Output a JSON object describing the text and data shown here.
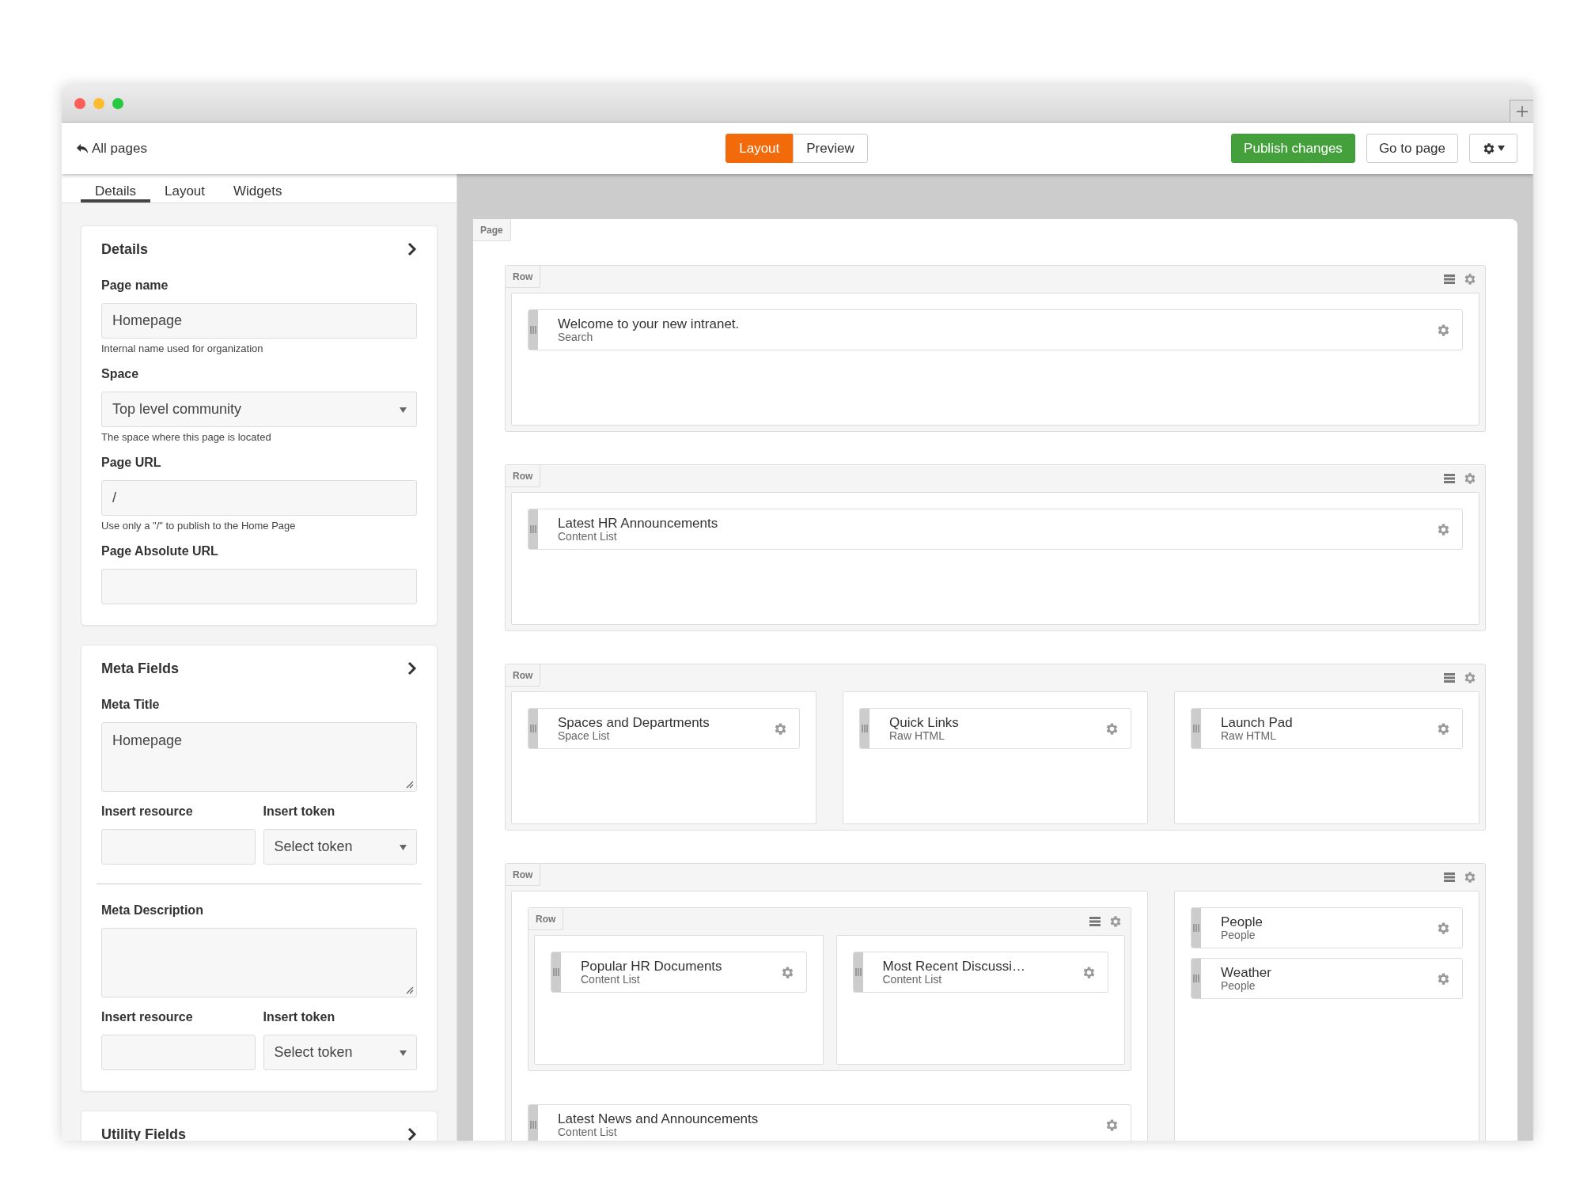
{
  "toolbar": {
    "back": "All pages",
    "modes": [
      {
        "label": "Layout",
        "selected": true
      },
      {
        "label": "Preview",
        "selected": false
      }
    ],
    "publish": "Publish changes",
    "go_to_page": "Go to page"
  },
  "sidebar": {
    "tabs": [
      {
        "label": "Details",
        "selected": true
      },
      {
        "label": "Layout",
        "selected": false
      },
      {
        "label": "Widgets",
        "selected": false
      }
    ],
    "sections": [
      {
        "title": "Details",
        "fields": [
          {
            "kind": "text",
            "label": "Page name",
            "value": "Homepage",
            "help": "Internal name used for organization"
          },
          {
            "kind": "select",
            "label": "Space",
            "value": "Top level community",
            "help": "The space where this page is located"
          },
          {
            "kind": "text",
            "label": "Page URL",
            "value": "/",
            "help": "Use only a \"/\" to publish to the Home Page"
          },
          {
            "kind": "text",
            "label": "Page Absolute URL"
          }
        ]
      },
      {
        "title": "Meta Fields",
        "fields": [
          {
            "kind": "textarea",
            "label": "Meta Title",
            "value": "Homepage"
          },
          {
            "kind": "pair",
            "fields": [
              {
                "kind": "text",
                "label": "Insert resource"
              },
              {
                "kind": "select",
                "label": "Insert token",
                "value": "Select token"
              }
            ]
          },
          {
            "kind": "textarea",
            "label": "Meta Description"
          },
          {
            "kind": "pair",
            "fields": [
              {
                "kind": "text",
                "label": "Insert resource"
              },
              {
                "kind": "select",
                "label": "Insert token",
                "value": "Select token"
              }
            ]
          }
        ]
      },
      {
        "title": "Utility Fields"
      }
    ]
  },
  "canvas": {
    "label": "Page",
    "rows": [
      {
        "label": "Row",
        "columns": [
          {
            "items": [
              {
                "kind": "widget",
                "title": "Welcome to your new intranet.",
                "type": "Search"
              }
            ]
          }
        ]
      },
      {
        "label": "Row",
        "columns": [
          {
            "items": [
              {
                "kind": "widget",
                "title": "Latest HR Announcements",
                "type": "Content List"
              }
            ]
          }
        ]
      },
      {
        "label": "Row",
        "columns": [
          {
            "items": [
              {
                "kind": "widget",
                "title": "Spaces and Departments",
                "type": "Space List"
              }
            ]
          },
          {
            "items": [
              {
                "kind": "widget",
                "title": "Quick Links",
                "type": "Raw HTML"
              }
            ]
          },
          {
            "items": [
              {
                "kind": "widget",
                "title": "Launch Pad",
                "type": "Raw HTML"
              }
            ]
          }
        ]
      },
      {
        "label": "Row",
        "columns": [
          {
            "items": [
              {
                "kind": "row",
                "label": "Row",
                "columns": [
                  {
                    "items": [
                      {
                        "kind": "widget",
                        "title": "Popular HR Documents",
                        "type": "Content List"
                      }
                    ]
                  },
                  {
                    "items": [
                      {
                        "kind": "widget",
                        "title": "Most Recent Discussi…",
                        "type": "Content List"
                      }
                    ]
                  }
                ]
              },
              {
                "kind": "widget",
                "title": "Latest News and Announcements",
                "type": "Content List"
              }
            ]
          },
          {
            "items": [
              {
                "kind": "widget",
                "title": "People",
                "type": "People"
              },
              {
                "kind": "widget",
                "title": "Weather",
                "type": "People"
              }
            ]
          }
        ]
      }
    ]
  }
}
